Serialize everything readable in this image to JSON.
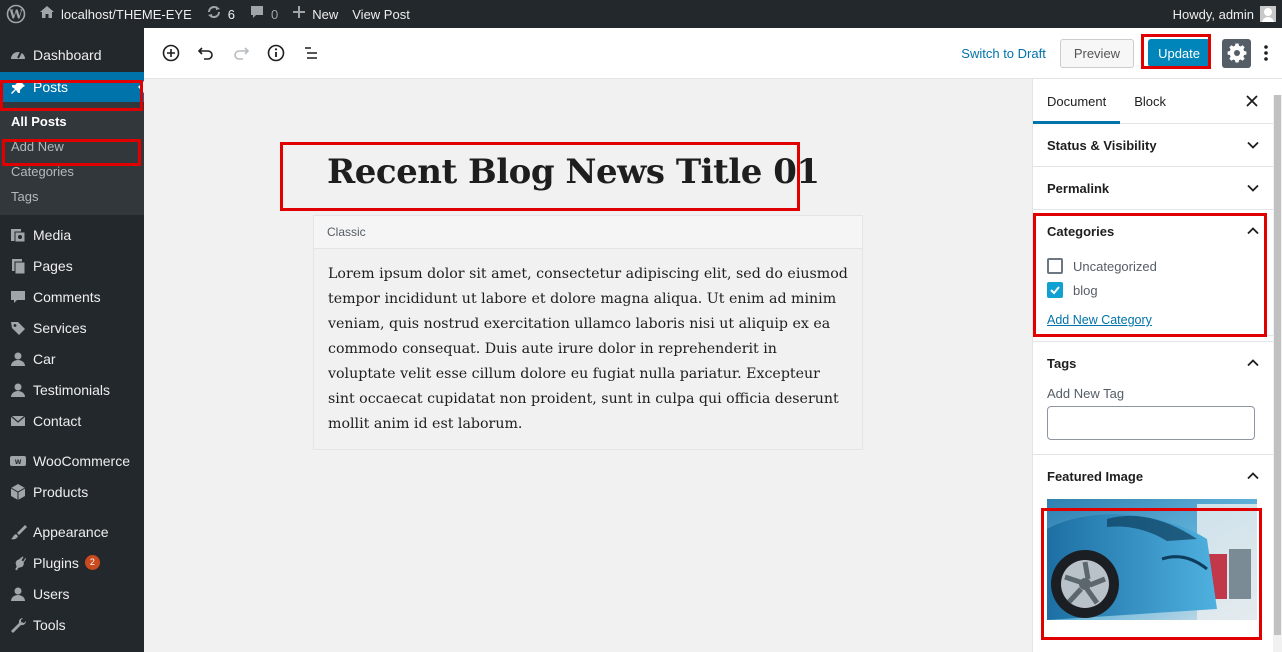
{
  "admin_bar": {
    "site_name": "localhost/THEME-EYE",
    "updates_count": "6",
    "comments_count": "0",
    "new_label": "New",
    "view_post_label": "View Post",
    "howdy": "Howdy, admin"
  },
  "sidebar": {
    "dashboard": "Dashboard",
    "posts": "Posts",
    "posts_submenu": [
      "All Posts",
      "Add New",
      "Categories",
      "Tags"
    ],
    "media": "Media",
    "pages": "Pages",
    "comments": "Comments",
    "services": "Services",
    "car": "Car",
    "testimonials": "Testimonials",
    "contact": "Contact",
    "woocommerce": "WooCommerce",
    "products": "Products",
    "appearance": "Appearance",
    "plugins": "Plugins",
    "plugins_badge": "2",
    "users": "Users",
    "tools": "Tools"
  },
  "toolbar": {
    "switch_to_draft": "Switch to Draft",
    "preview": "Preview",
    "update": "Update"
  },
  "editor": {
    "title": "Recent Blog News Title 01",
    "classic_label": "Classic",
    "body": "Lorem ipsum dolor sit amet, consectetur adipiscing elit, sed do eiusmod tempor incididunt ut labore et dolore magna aliqua. Ut enim ad minim veniam, quis nostrud exercitation ullamco laboris nisi ut aliquip ex ea commodo consequat. Duis aute irure dolor in reprehenderit in voluptate velit esse cillum dolore eu fugiat nulla pariatur. Excepteur sint occaecat cupidatat non proident, sunt in culpa qui officia deserunt mollit anim id est laborum."
  },
  "settings": {
    "tab_document": "Document",
    "tab_block": "Block",
    "status_visibility": "Status & Visibility",
    "permalink": "Permalink",
    "categories_title": "Categories",
    "categories": [
      {
        "label": "Uncategorized",
        "checked": false
      },
      {
        "label": "blog",
        "checked": true
      }
    ],
    "add_new_category": "Add New Category",
    "tags_title": "Tags",
    "add_new_tag": "Add New Tag",
    "featured_image_title": "Featured Image"
  },
  "colors": {
    "admin_dark": "#23282d",
    "accent_blue": "#0073aa",
    "update_blue": "#0085ba",
    "highlight_red": "#e00000"
  }
}
